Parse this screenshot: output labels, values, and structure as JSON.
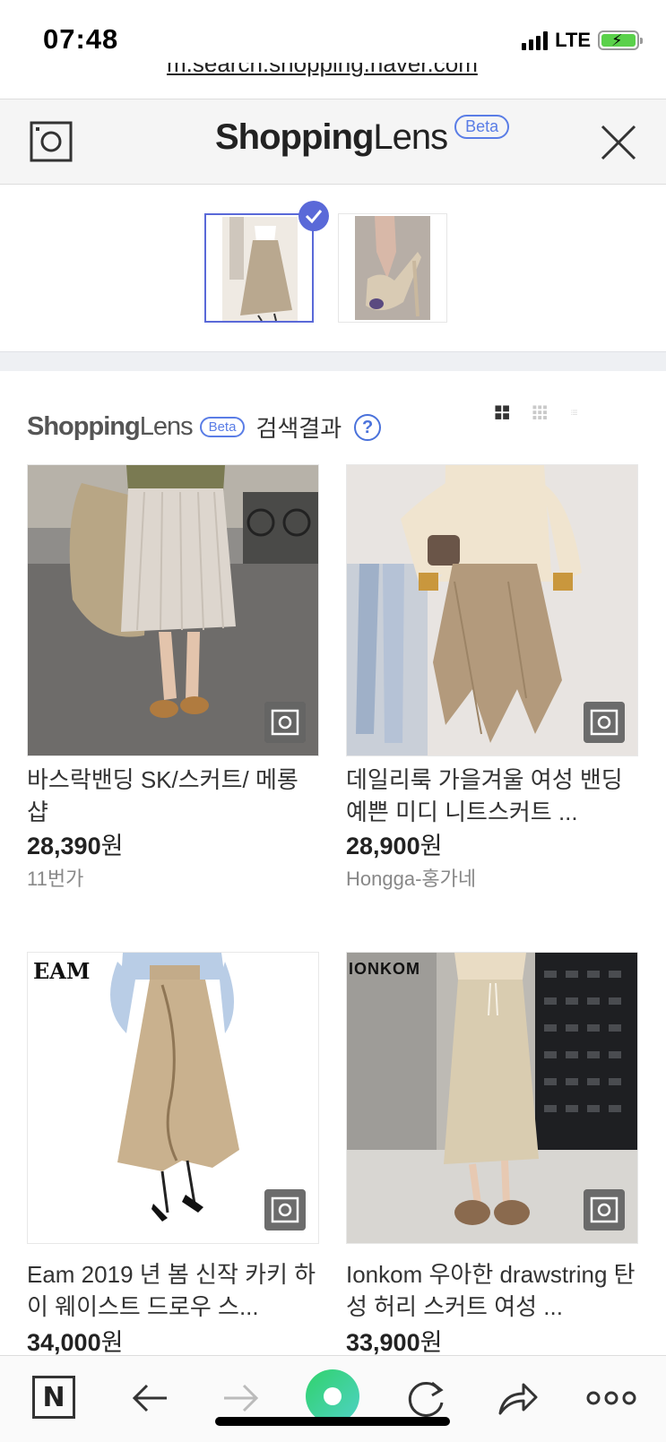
{
  "status": {
    "time": "07:48",
    "network": "LTE"
  },
  "browser": {
    "url": "m.search.shopping.naver.com"
  },
  "lens_header": {
    "brand_bold": "Shopping",
    "brand_light": "Lens",
    "beta": "Beta"
  },
  "results_header": {
    "brand_bold": "Shopping",
    "brand_light": "Lens",
    "beta": "Beta",
    "title": "검색결과",
    "help": "?"
  },
  "products": [
    {
      "title": "바스락밴딩 SK/스커트/ 메롱샵",
      "price": "28,390",
      "currency": "원",
      "seller": "11번가"
    },
    {
      "title": "데일리룩 가을겨울 여성 밴딩 예쁜 미디 니트스커트 ...",
      "price": "28,900",
      "currency": "원",
      "seller": "Hongga-홍가네"
    },
    {
      "title": "Eam 2019 년 봄 신작 카키 하이 웨이스트 드로우 스...",
      "price": "34,000",
      "currency": "원",
      "seller": "",
      "brand_mark": "EAM"
    },
    {
      "title": "Ionkom 우아한 drawstring 탄성 허리 스커트 여성 ...",
      "price": "33,900",
      "currency": "원",
      "seller": "",
      "brand_mark": "IONKOM"
    }
  ],
  "colors": {
    "accent": "#5a69d8",
    "beta": "#5a7de6",
    "help": "#4a72db"
  },
  "toolbar": {
    "n_label": "N"
  }
}
